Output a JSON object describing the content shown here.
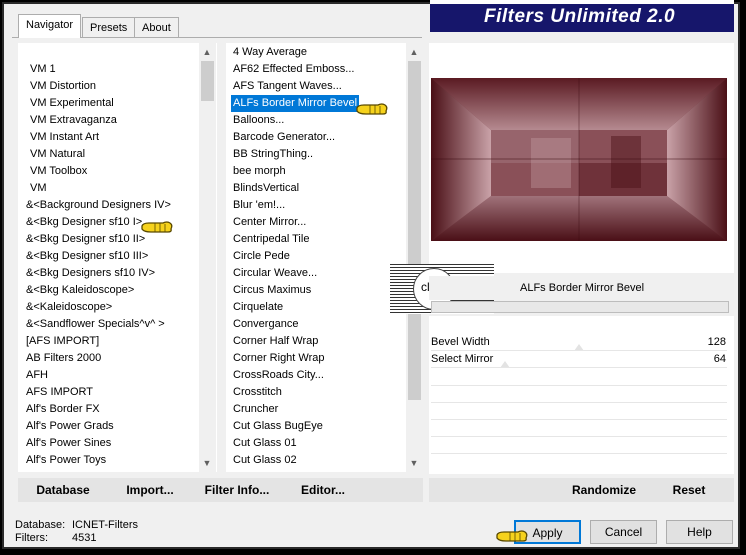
{
  "app": {
    "title": "Filters Unlimited 2.0"
  },
  "tabs": [
    {
      "label": "Navigator"
    },
    {
      "label": "Presets"
    },
    {
      "label": "About"
    }
  ],
  "categories": [
    "VM 1",
    "VM Distortion",
    "VM Experimental",
    "VM Extravaganza",
    "VM Instant Art",
    "VM Natural",
    "VM Toolbox",
    "VM",
    "&<Background Designers IV>",
    "&<Bkg Designer sf10 I>",
    "&<Bkg Designer sf10 II>",
    "&<Bkg Designer sf10 III>",
    "&<Bkg Designers sf10 IV>",
    "&<Bkg Kaleidoscope>",
    "&<Kaleidoscope>",
    "&<Sandflower Specials^v^ >",
    "[AFS IMPORT]",
    "AB Filters 2000",
    "AFH",
    "AFS IMPORT",
    "Alf's Border FX",
    "Alf's Power Grads",
    "Alf's Power Sines",
    "Alf's Power Toys"
  ],
  "filters": [
    "4 Way Average",
    "AF62 Effected Emboss...",
    "AFS Tangent Waves...",
    "ALFs Border Mirror Bevel",
    "Balloons...",
    "Barcode Generator...",
    "BB StringThing..",
    "bee morph",
    "BlindsVertical",
    "Blur 'em!...",
    "Center Mirror...",
    "Centripedal Tile",
    "Circle Pede",
    "Circular Weave...",
    "Circus Maximus",
    "Cirquelate",
    "Convergance",
    "Corner Half Wrap",
    "Corner Right Wrap",
    "CrossRoads City...",
    "Crosstitch",
    "Cruncher",
    "Cut Glass  BugEye",
    "Cut Glass 01",
    "Cut Glass 02"
  ],
  "selected_filter": "ALFs Border Mirror Bevel",
  "watermark": {
    "text": "claudia"
  },
  "params": [
    {
      "label": "Bevel Width",
      "value": "128",
      "level": 0.5
    },
    {
      "label": "Select Mirror",
      "value": "64",
      "level": 0.25
    }
  ],
  "toolbar": {
    "database": "Database",
    "import": "Import...",
    "filter_info": "Filter Info...",
    "editor": "Editor...",
    "randomize": "Randomize",
    "reset": "Reset"
  },
  "status": {
    "database_label": "Database:",
    "database_value": "ICNET-Filters",
    "filters_label": "Filters:",
    "filters_value": "4531"
  },
  "buttons": {
    "apply": "Apply",
    "cancel": "Cancel",
    "help": "Help"
  },
  "colors": {
    "preview_dark": "#4a0f16",
    "preview_mid": "#7a3a42",
    "preview_light": "#c9a2a8",
    "selection": "#0078d7",
    "banner": "#16166b"
  }
}
